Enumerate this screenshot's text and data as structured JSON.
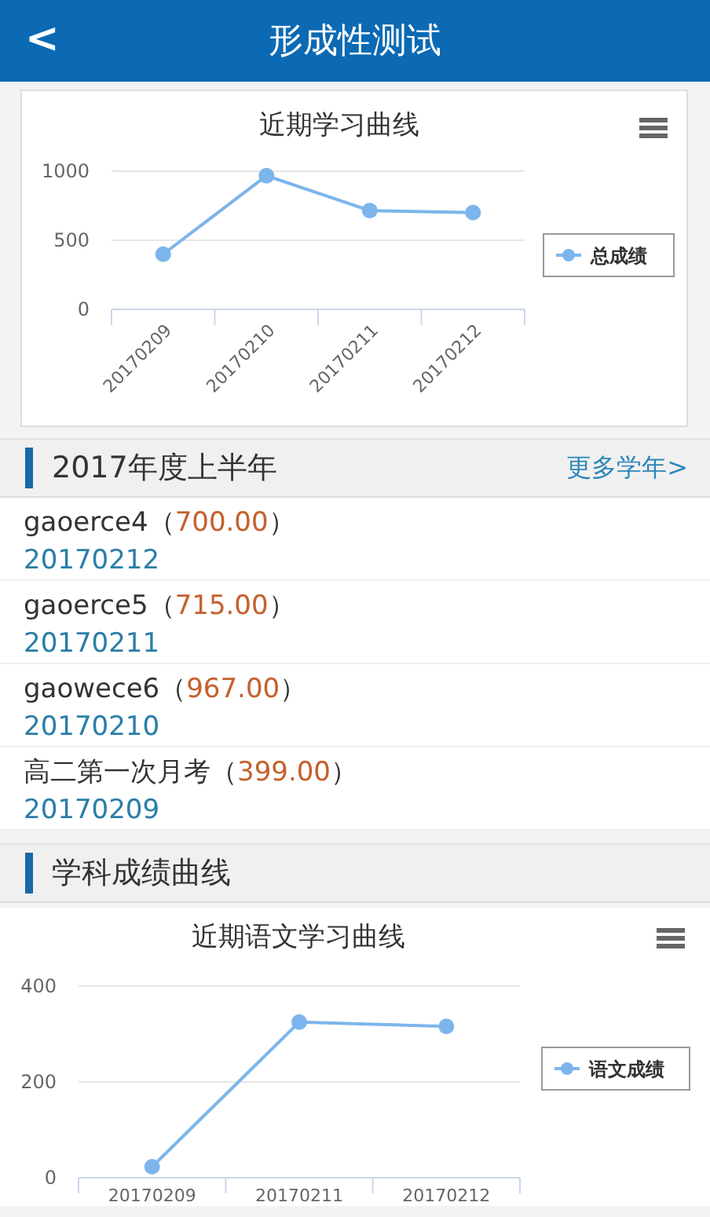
{
  "header": {
    "back_icon": "<",
    "title": "形成性测试"
  },
  "overview_chart": {
    "chart_data": {
      "type": "line",
      "title": "近期学习曲线",
      "categories": [
        "20170209",
        "20170210",
        "20170211",
        "20170212"
      ],
      "series": [
        {
          "name": "总成绩",
          "color": "#7cb5ec",
          "marker": "circle",
          "values": [
            399,
            967,
            715,
            700
          ]
        }
      ],
      "ylim": [
        0,
        1000
      ],
      "yticks": [
        0,
        500,
        1000
      ]
    }
  },
  "term_section": {
    "title": "2017年度上半年",
    "link": "更多学年>"
  },
  "exams": [
    {
      "prefix": "gaoerce4（",
      "score": "700.00",
      "suffix": "）",
      "date": "20170212"
    },
    {
      "prefix": "gaoerce5（",
      "score": "715.00",
      "suffix": "）",
      "date": "20170211"
    },
    {
      "prefix": "gaowece6（",
      "score": "967.00",
      "suffix": "）",
      "date": "20170210"
    },
    {
      "prefix": "高二第一次月考（",
      "score": "399.00",
      "suffix": "）",
      "date": "20170209"
    }
  ],
  "subject_section": {
    "title": "学科成绩曲线"
  },
  "subject_chart": {
    "chart_data": {
      "type": "line",
      "title": "近期语文学习曲线",
      "categories": [
        "20170209",
        "20170211",
        "20170212"
      ],
      "series": [
        {
          "name": "语文成绩",
          "color": "#7cb5ec",
          "marker": "circle",
          "values": [
            23,
            325,
            316
          ]
        }
      ],
      "ylim": [
        0,
        400
      ],
      "yticks": [
        0,
        200,
        400
      ]
    }
  }
}
